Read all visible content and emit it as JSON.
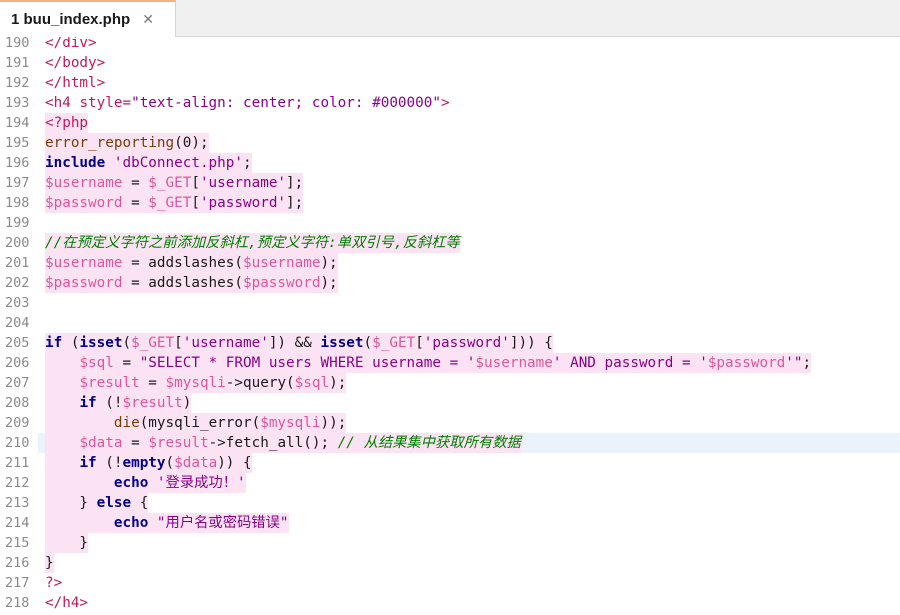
{
  "tab": {
    "label": "1 buu_index.php",
    "close": "✕"
  },
  "current_line": 210,
  "lines": [
    {
      "n": "190",
      "hl": false,
      "t": [
        {
          "c": "t-tag",
          "v": "</div>"
        }
      ]
    },
    {
      "n": "191",
      "hl": false,
      "t": [
        {
          "c": "t-tag",
          "v": "</body>"
        }
      ]
    },
    {
      "n": "192",
      "hl": false,
      "t": [
        {
          "c": "t-tag",
          "v": "</html>"
        }
      ]
    },
    {
      "n": "193",
      "hl": false,
      "t": [
        {
          "c": "t-tag",
          "v": "<h4 "
        },
        {
          "c": "t-att",
          "v": "style="
        },
        {
          "c": "t-str",
          "v": "\"text-align: center; color: #000000\""
        },
        {
          "c": "t-tag",
          "v": ">"
        }
      ]
    },
    {
      "n": "194",
      "hl": true,
      "t": [
        {
          "c": "t-tag",
          "v": "<?php"
        }
      ]
    },
    {
      "n": "195",
      "hl": true,
      "t": [
        {
          "c": "t-fn",
          "v": "error_reporting"
        },
        {
          "c": "t-text",
          "v": "("
        },
        {
          "c": "t-num",
          "v": "0"
        },
        {
          "c": "t-text",
          "v": ");"
        }
      ]
    },
    {
      "n": "196",
      "hl": true,
      "t": [
        {
          "c": "t-kw",
          "v": "include"
        },
        {
          "c": "t-text",
          "v": " "
        },
        {
          "c": "t-str",
          "v": "'dbConnect.php'"
        },
        {
          "c": "t-text",
          "v": ";"
        }
      ]
    },
    {
      "n": "197",
      "hl": true,
      "t": [
        {
          "c": "t-var",
          "v": "$username"
        },
        {
          "c": "t-text",
          "v": " = "
        },
        {
          "c": "t-var",
          "v": "$_GET"
        },
        {
          "c": "t-text",
          "v": "["
        },
        {
          "c": "t-str",
          "v": "'username'"
        },
        {
          "c": "t-text",
          "v": "];"
        }
      ]
    },
    {
      "n": "198",
      "hl": true,
      "t": [
        {
          "c": "t-var",
          "v": "$password"
        },
        {
          "c": "t-text",
          "v": " = "
        },
        {
          "c": "t-var",
          "v": "$_GET"
        },
        {
          "c": "t-text",
          "v": "["
        },
        {
          "c": "t-str",
          "v": "'password'"
        },
        {
          "c": "t-text",
          "v": "];"
        }
      ]
    },
    {
      "n": "199",
      "hl": false,
      "t": []
    },
    {
      "n": "200",
      "hl": true,
      "t": [
        {
          "c": "t-cmt",
          "v": "//在预定义字符之前添加反斜杠,预定义字符:单双引号,反斜杠等"
        }
      ]
    },
    {
      "n": "201",
      "hl": true,
      "t": [
        {
          "c": "t-var",
          "v": "$username"
        },
        {
          "c": "t-text",
          "v": " = addslashes("
        },
        {
          "c": "t-var",
          "v": "$username"
        },
        {
          "c": "t-text",
          "v": ");"
        }
      ]
    },
    {
      "n": "202",
      "hl": true,
      "t": [
        {
          "c": "t-var",
          "v": "$password"
        },
        {
          "c": "t-text",
          "v": " = addslashes("
        },
        {
          "c": "t-var",
          "v": "$password"
        },
        {
          "c": "t-text",
          "v": ");"
        }
      ]
    },
    {
      "n": "203",
      "hl": false,
      "t": []
    },
    {
      "n": "204",
      "hl": false,
      "t": []
    },
    {
      "n": "205",
      "hl": true,
      "t": [
        {
          "c": "t-kw",
          "v": "if"
        },
        {
          "c": "t-text",
          "v": " ("
        },
        {
          "c": "t-kw",
          "v": "isset"
        },
        {
          "c": "t-text",
          "v": "("
        },
        {
          "c": "t-var",
          "v": "$_GET"
        },
        {
          "c": "t-text",
          "v": "["
        },
        {
          "c": "t-str",
          "v": "'username'"
        },
        {
          "c": "t-text",
          "v": "]) && "
        },
        {
          "c": "t-kw",
          "v": "isset"
        },
        {
          "c": "t-text",
          "v": "("
        },
        {
          "c": "t-var",
          "v": "$_GET"
        },
        {
          "c": "t-text",
          "v": "["
        },
        {
          "c": "t-str",
          "v": "'password'"
        },
        {
          "c": "t-text",
          "v": "])) {"
        }
      ]
    },
    {
      "n": "206",
      "hl": true,
      "t": [
        {
          "c": "t-text",
          "v": "    "
        },
        {
          "c": "t-var",
          "v": "$sql"
        },
        {
          "c": "t-text",
          "v": " = "
        },
        {
          "c": "t-str",
          "v": "\"SELECT * FROM users WHERE username = '"
        },
        {
          "c": "t-var",
          "v": "$username"
        },
        {
          "c": "t-str",
          "v": "' AND password = '"
        },
        {
          "c": "t-var",
          "v": "$password"
        },
        {
          "c": "t-str",
          "v": "'\""
        },
        {
          "c": "t-text",
          "v": ";"
        }
      ]
    },
    {
      "n": "207",
      "hl": true,
      "t": [
        {
          "c": "t-text",
          "v": "    "
        },
        {
          "c": "t-var",
          "v": "$result"
        },
        {
          "c": "t-text",
          "v": " = "
        },
        {
          "c": "t-var",
          "v": "$mysqli"
        },
        {
          "c": "t-text",
          "v": "->query("
        },
        {
          "c": "t-var",
          "v": "$sql"
        },
        {
          "c": "t-text",
          "v": ");"
        }
      ]
    },
    {
      "n": "208",
      "hl": true,
      "t": [
        {
          "c": "t-text",
          "v": "    "
        },
        {
          "c": "t-kw",
          "v": "if"
        },
        {
          "c": "t-text",
          "v": " (!"
        },
        {
          "c": "t-var",
          "v": "$result"
        },
        {
          "c": "t-text",
          "v": ")"
        }
      ]
    },
    {
      "n": "209",
      "hl": true,
      "t": [
        {
          "c": "t-text",
          "v": "        "
        },
        {
          "c": "t-fn",
          "v": "die"
        },
        {
          "c": "t-text",
          "v": "(mysqli_error("
        },
        {
          "c": "t-var",
          "v": "$mysqli"
        },
        {
          "c": "t-text",
          "v": "));"
        }
      ]
    },
    {
      "n": "210",
      "hl": true,
      "t": [
        {
          "c": "t-text",
          "v": "    "
        },
        {
          "c": "t-var",
          "v": "$data"
        },
        {
          "c": "t-text",
          "v": " = "
        },
        {
          "c": "t-var",
          "v": "$result"
        },
        {
          "c": "t-text",
          "v": "->fetch_all(); "
        },
        {
          "c": "t-cmt",
          "v": "// 从结果集中获取所有数据"
        }
      ]
    },
    {
      "n": "211",
      "hl": true,
      "t": [
        {
          "c": "t-text",
          "v": "    "
        },
        {
          "c": "t-kw",
          "v": "if"
        },
        {
          "c": "t-text",
          "v": " (!"
        },
        {
          "c": "t-kw",
          "v": "empty"
        },
        {
          "c": "t-text",
          "v": "("
        },
        {
          "c": "t-var",
          "v": "$data"
        },
        {
          "c": "t-text",
          "v": ")) {"
        }
      ]
    },
    {
      "n": "212",
      "hl": true,
      "t": [
        {
          "c": "t-text",
          "v": "        "
        },
        {
          "c": "t-kw",
          "v": "echo"
        },
        {
          "c": "t-text",
          "v": " "
        },
        {
          "c": "t-str",
          "v": "'登录成功！'"
        }
      ]
    },
    {
      "n": "213",
      "hl": true,
      "t": [
        {
          "c": "t-text",
          "v": "    } "
        },
        {
          "c": "t-kw",
          "v": "else"
        },
        {
          "c": "t-text",
          "v": " {"
        }
      ]
    },
    {
      "n": "214",
      "hl": true,
      "t": [
        {
          "c": "t-text",
          "v": "        "
        },
        {
          "c": "t-kw",
          "v": "echo"
        },
        {
          "c": "t-text",
          "v": " "
        },
        {
          "c": "t-str",
          "v": "\"用户名或密码错误\""
        }
      ]
    },
    {
      "n": "215",
      "hl": true,
      "t": [
        {
          "c": "t-text",
          "v": "    }"
        }
      ]
    },
    {
      "n": "216",
      "hl": true,
      "t": [
        {
          "c": "t-text",
          "v": "}"
        }
      ]
    },
    {
      "n": "217",
      "hl": false,
      "t": [
        {
          "c": "t-tag",
          "v": "?>"
        }
      ]
    },
    {
      "n": "218",
      "hl": false,
      "t": [
        {
          "c": "t-tag",
          "v": "</h4>"
        }
      ]
    }
  ]
}
